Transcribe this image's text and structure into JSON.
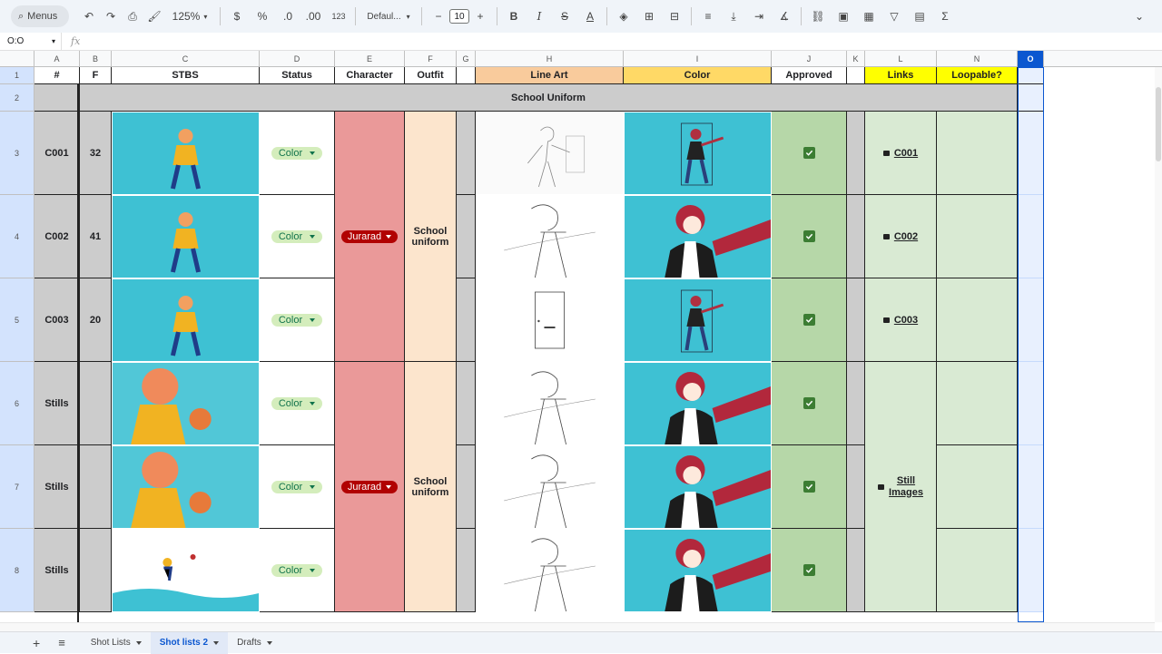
{
  "toolbar": {
    "search_label": "Menus",
    "zoom": "125%",
    "currency": "$",
    "percent": "%",
    "decrease_decimal": ".0",
    "increase_decimal": ".00",
    "number_format": "123",
    "font": "Defaul...",
    "font_size": "10",
    "bold": "B",
    "italic": "I",
    "strike": "S",
    "text_color": "A",
    "function": "Σ"
  },
  "formula_bar": {
    "name_box": "O:O",
    "fx": "fx"
  },
  "columns": [
    "A",
    "B",
    "C",
    "D",
    "E",
    "F",
    "G",
    "H",
    "I",
    "J",
    "K",
    "L",
    "N",
    "O"
  ],
  "rows": [
    "1",
    "2",
    "3",
    "4",
    "5",
    "6",
    "7",
    "8"
  ],
  "headers": {
    "num": "#",
    "f": "F",
    "stbs": "STBS",
    "status": "Status",
    "character": "Character",
    "outfit": "Outfit",
    "line_art": "Line Art",
    "color": "Color",
    "approved": "Approved",
    "links": "Links",
    "loopable": "Loopable?"
  },
  "section_title": "School Uniform",
  "shots": [
    {
      "id": "C001",
      "frames": "32",
      "status": "Color",
      "link": "C001"
    },
    {
      "id": "C002",
      "frames": "41",
      "status": "Color",
      "link": "C002"
    },
    {
      "id": "C003",
      "frames": "20",
      "status": "Color",
      "link": "C003"
    },
    {
      "id": "Stills",
      "frames": "",
      "status": "Color"
    },
    {
      "id": "Stills",
      "frames": "",
      "status": "Color"
    },
    {
      "id": "Stills",
      "frames": "",
      "status": "Color"
    }
  ],
  "groups": [
    {
      "character": "Jurarad",
      "outfit_line1": "School",
      "outfit_line2": "uniform"
    },
    {
      "character": "Jurarad",
      "outfit_line1": "School",
      "outfit_line2": "uniform",
      "link_line1": "Still",
      "link_line2": "Images"
    }
  ],
  "sheet_tabs": [
    {
      "label": "Shot Lists",
      "active": false
    },
    {
      "label": "Shot lists 2",
      "active": true
    },
    {
      "label": "Drafts",
      "active": false
    }
  ],
  "colors": {
    "teal": "#3ec1d3",
    "character_bg": "#ea9999",
    "outfit_bg": "#fce5cd",
    "lineart_hdr": "#f9cb9c",
    "color_hdr": "#ffd966",
    "approved_bg": "#b6d7a8",
    "links_hdr": "#ffff00",
    "light_green": "#d9ead3",
    "grey": "#cccccc",
    "selected_col": "#e8f0fe",
    "chip_green": "#d4edbc",
    "chip_red": "#b10202"
  }
}
